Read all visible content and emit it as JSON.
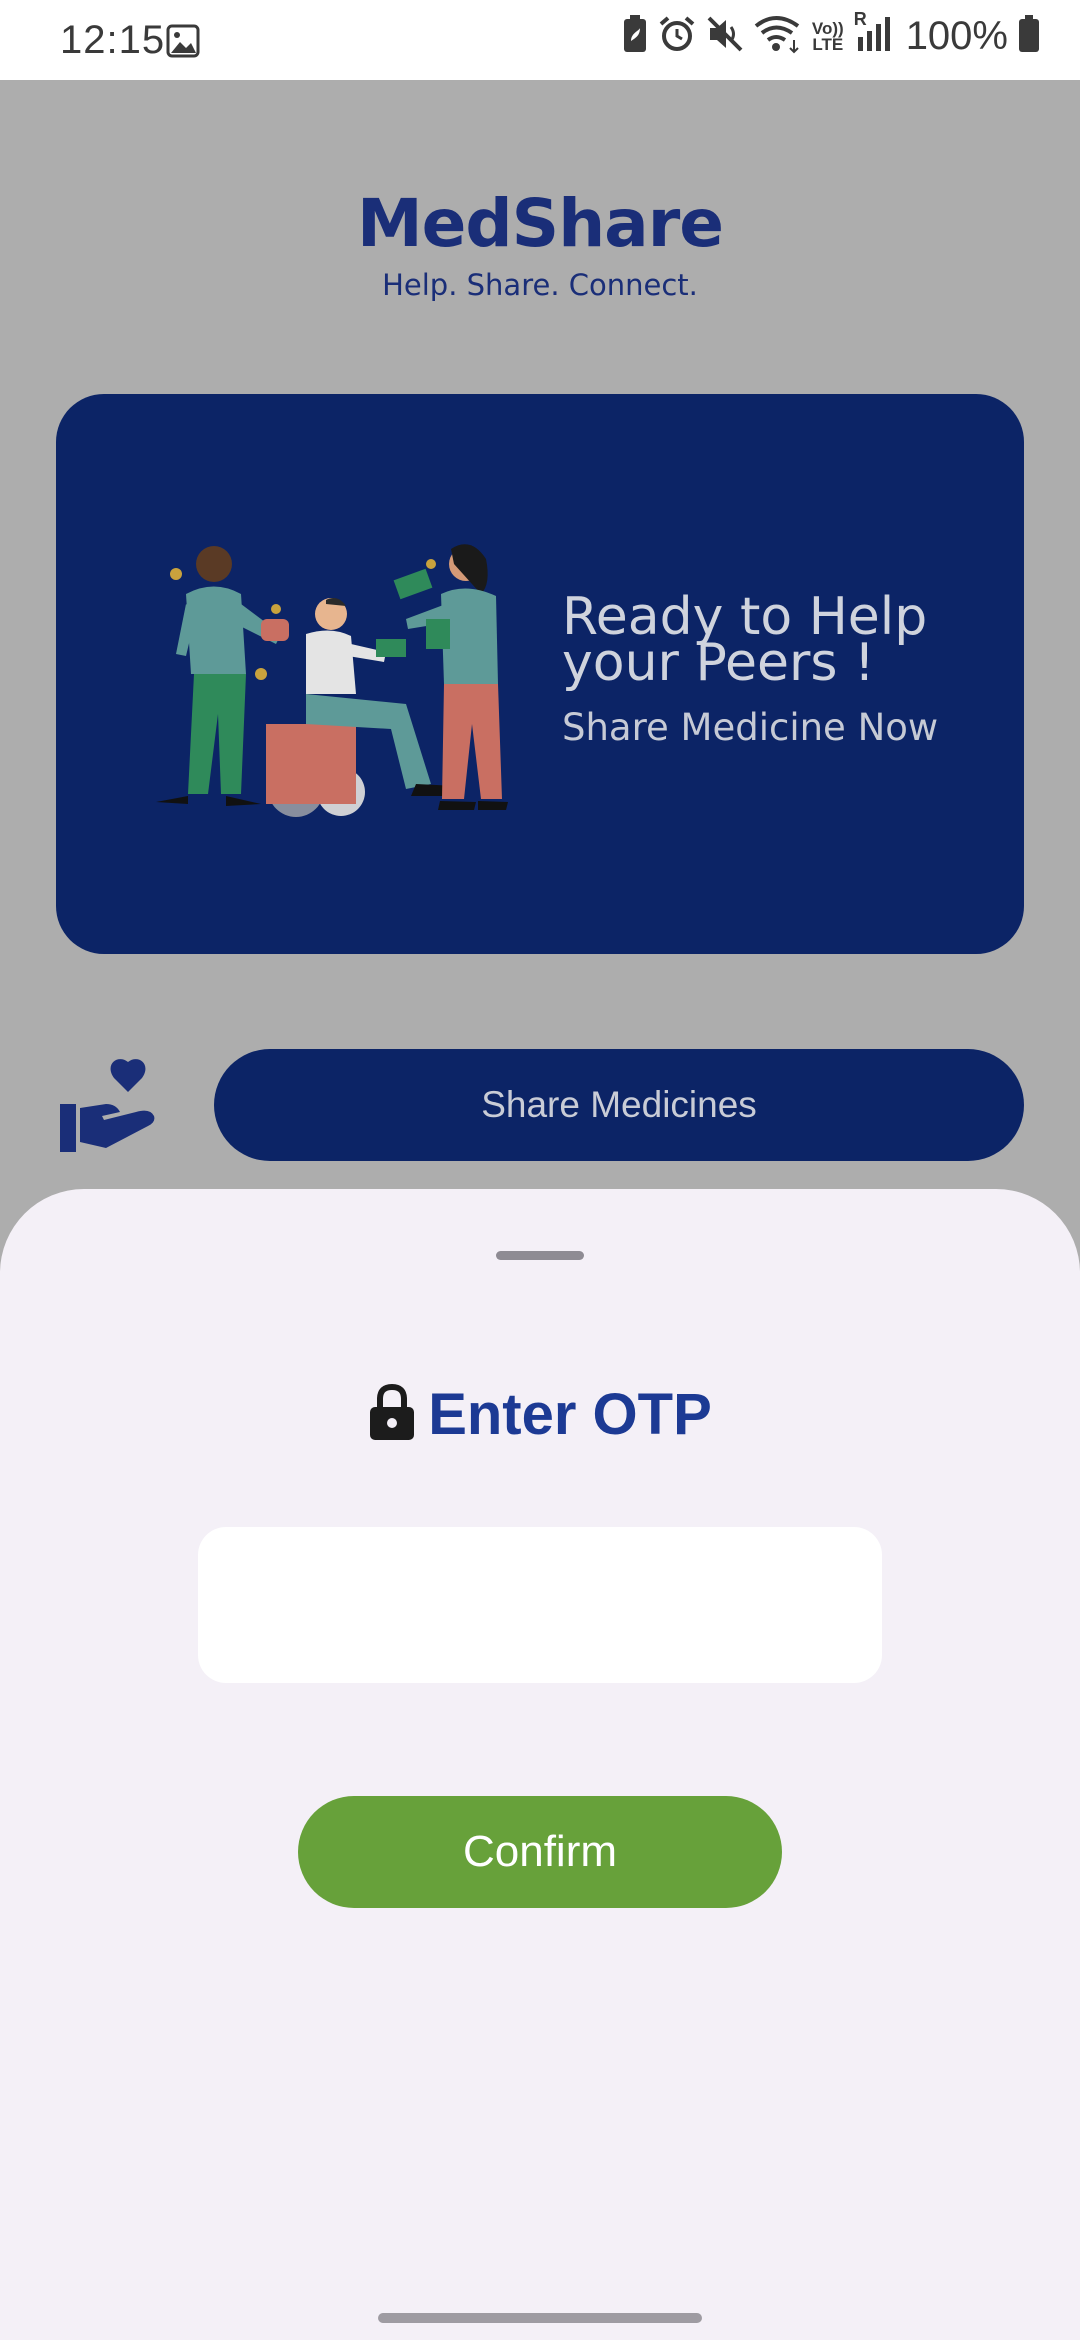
{
  "status_bar": {
    "time": "12:15",
    "battery": "100%",
    "icons": [
      "image-icon",
      "battery-saver-icon",
      "alarm-icon",
      "mute-icon",
      "wifi-icon",
      "volte-icon",
      "signal-icon",
      "battery-icon"
    ],
    "volte_label_top": "Vo))",
    "volte_label_bottom": "LTE",
    "roaming_label": "R"
  },
  "header": {
    "title": "MedShare",
    "tagline": "Help. Share. Connect."
  },
  "banner": {
    "heading": "Ready to Help your Peers !",
    "subheading": "Share Medicine Now",
    "background": "#0c2466"
  },
  "share": {
    "icon": "hand-heart-icon",
    "button_label": "Share Medicines"
  },
  "otp_sheet": {
    "title": "Enter OTP",
    "title_icon": "lock-icon",
    "input_value": "",
    "confirm_label": "Confirm",
    "confirm_color": "#67a13a",
    "accent": "#1c3a94"
  }
}
